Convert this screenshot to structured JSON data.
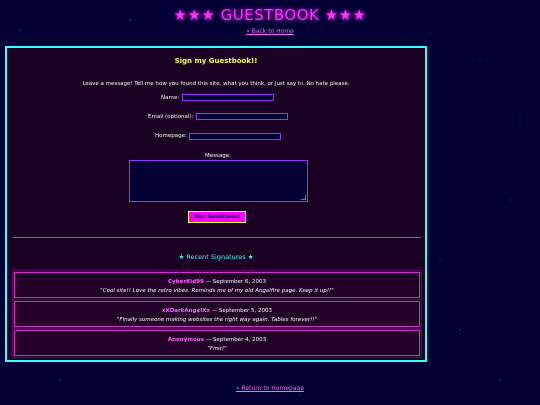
{
  "header": {
    "title": "★★★ GUESTBOOK ★★★",
    "back_link": "« Back to Home"
  },
  "form": {
    "title": "Sign my Guestbook!!",
    "intro": "Leave a message! Tell me how you found this site, what you think, or just say hi. No hate please.",
    "name_label": "Name:",
    "name_value": "",
    "email_label": "Email (optional):",
    "email_value": "",
    "homepage_label": "Homepage:",
    "homepage_value": "",
    "message_label": "Message:",
    "message_value": "",
    "submit_label": "Sign Guestbook!"
  },
  "recent": {
    "title": "★ Recent Signatures ★",
    "entries": [
      {
        "name": "CyberKid99",
        "date": "September 6, 2003",
        "message": "\"Cool site!! Love the retro vibes. Reminds me of my old Angelfire page. Keep it up!!\""
      },
      {
        "name": "xXDarkAngelXx",
        "date": "September 5, 2003",
        "message": "\"Finally someone making websites the right way again. Tables forever!!\""
      },
      {
        "name": "Anonymous",
        "date": "September 4, 2003",
        "message": "\"First!\""
      }
    ]
  },
  "footer": {
    "return_link": "« Return to Homepage"
  },
  "colors": {
    "background": "#000033",
    "panel": "#1a0022",
    "panel_border": "#33ffff",
    "accent_pink": "#ff33ff",
    "accent_yellow": "#ffff33"
  }
}
